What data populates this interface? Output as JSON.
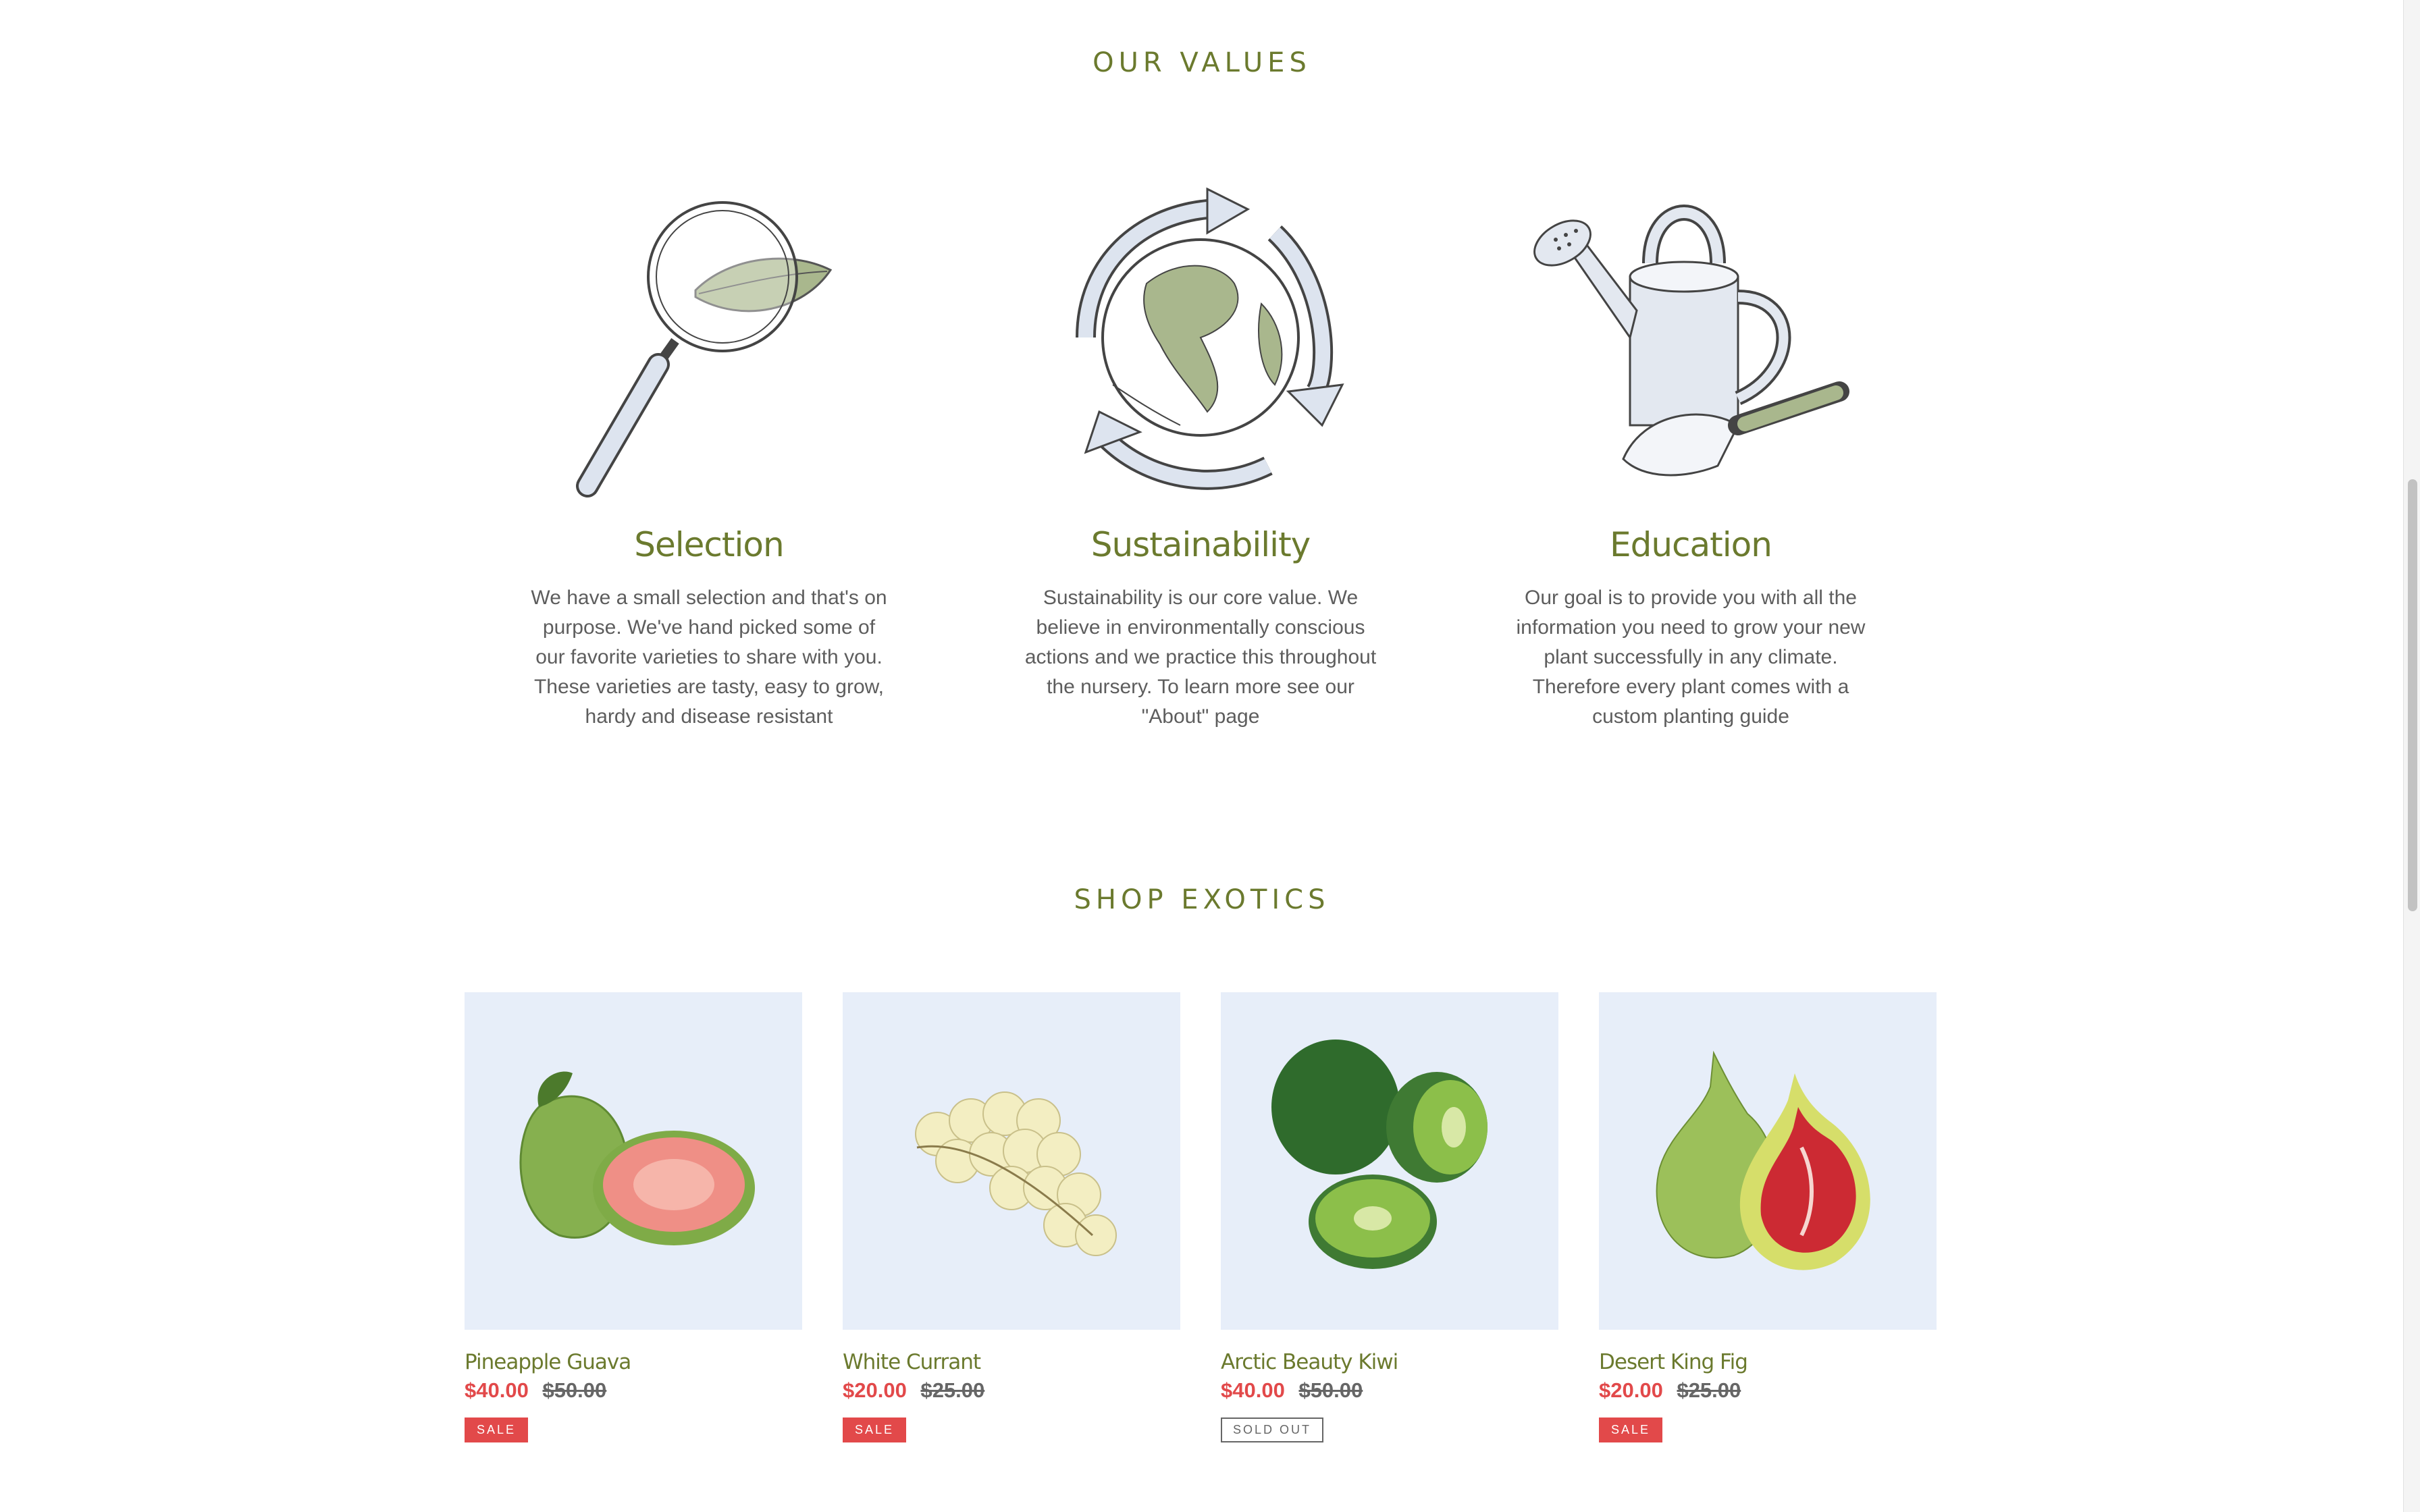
{
  "values": {
    "title": "OUR VALUES",
    "items": [
      {
        "icon": "magnifying-glass-leaf-icon",
        "heading": "Selection",
        "text": "We have a small selection and that's on purpose. We've hand picked some of our favorite varieties to share with you. These varieties are tasty, easy to grow, hardy and disease resistant"
      },
      {
        "icon": "recycling-globe-icon",
        "heading": "Sustainability",
        "text": "Sustainability is our core value. We believe in environmentally conscious actions and we practice this throughout the nursery. To learn more see our \"About\" page"
      },
      {
        "icon": "watering-can-trowel-icon",
        "heading": "Education",
        "text": "Our goal is to provide you with all the information you need to grow your new plant successfully in any climate. Therefore every plant comes with a custom planting guide"
      }
    ]
  },
  "shop": {
    "title": "SHOP EXOTICS",
    "products": [
      {
        "name": "Pineapple Guava",
        "sale_price": "$40.00",
        "regular_price": "$50.00",
        "badge": "SALE",
        "image": "guava-image"
      },
      {
        "name": "White Currant",
        "sale_price": "$20.00",
        "regular_price": "$25.00",
        "badge": "SALE",
        "image": "white-currant-image"
      },
      {
        "name": "Arctic Beauty Kiwi",
        "sale_price": "$40.00",
        "regular_price": "$50.00",
        "badge": "SOLD OUT",
        "image": "kiwi-image"
      },
      {
        "name": "Desert King Fig",
        "sale_price": "$20.00",
        "regular_price": "$25.00",
        "badge": "SALE",
        "image": "fig-image"
      }
    ]
  },
  "colors": {
    "accent_green": "#6b7a2e",
    "sale_red": "#e2494a",
    "image_bg": "#e7eef9"
  }
}
